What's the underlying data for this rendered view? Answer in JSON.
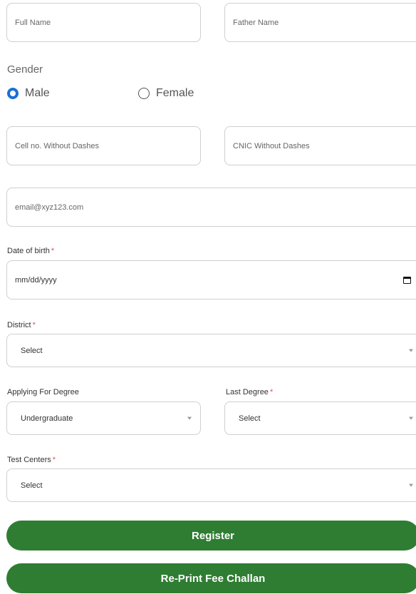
{
  "form": {
    "full_name_placeholder": "Full Name",
    "father_name_placeholder": "Father Name",
    "gender_label": "Gender",
    "gender_options": [
      {
        "label": "Male",
        "selected": true
      },
      {
        "label": "Female",
        "selected": false
      }
    ],
    "cell_placeholder": "Cell no. Without Dashes",
    "cnic_placeholder": "CNIC Without Dashes",
    "email_placeholder": "email@xyz123.com",
    "dob_label": "Date of birth",
    "dob_placeholder": "mm/dd/yyyy",
    "district_label": "District",
    "district_value": "Select",
    "degree_label": "Applying For Degree",
    "degree_value": "Undergraduate",
    "last_degree_label": "Last Degree",
    "last_degree_value": "Select",
    "test_centers_label": "Test Centers",
    "test_centers_value": "Select",
    "required_mark": "*"
  },
  "buttons": {
    "register": "Register",
    "reprint": "Re-Print Fee Challan"
  },
  "colors": {
    "primary_green": "#2e7d32",
    "radio_blue": "#1b6fd6",
    "required_red": "#e05252"
  }
}
